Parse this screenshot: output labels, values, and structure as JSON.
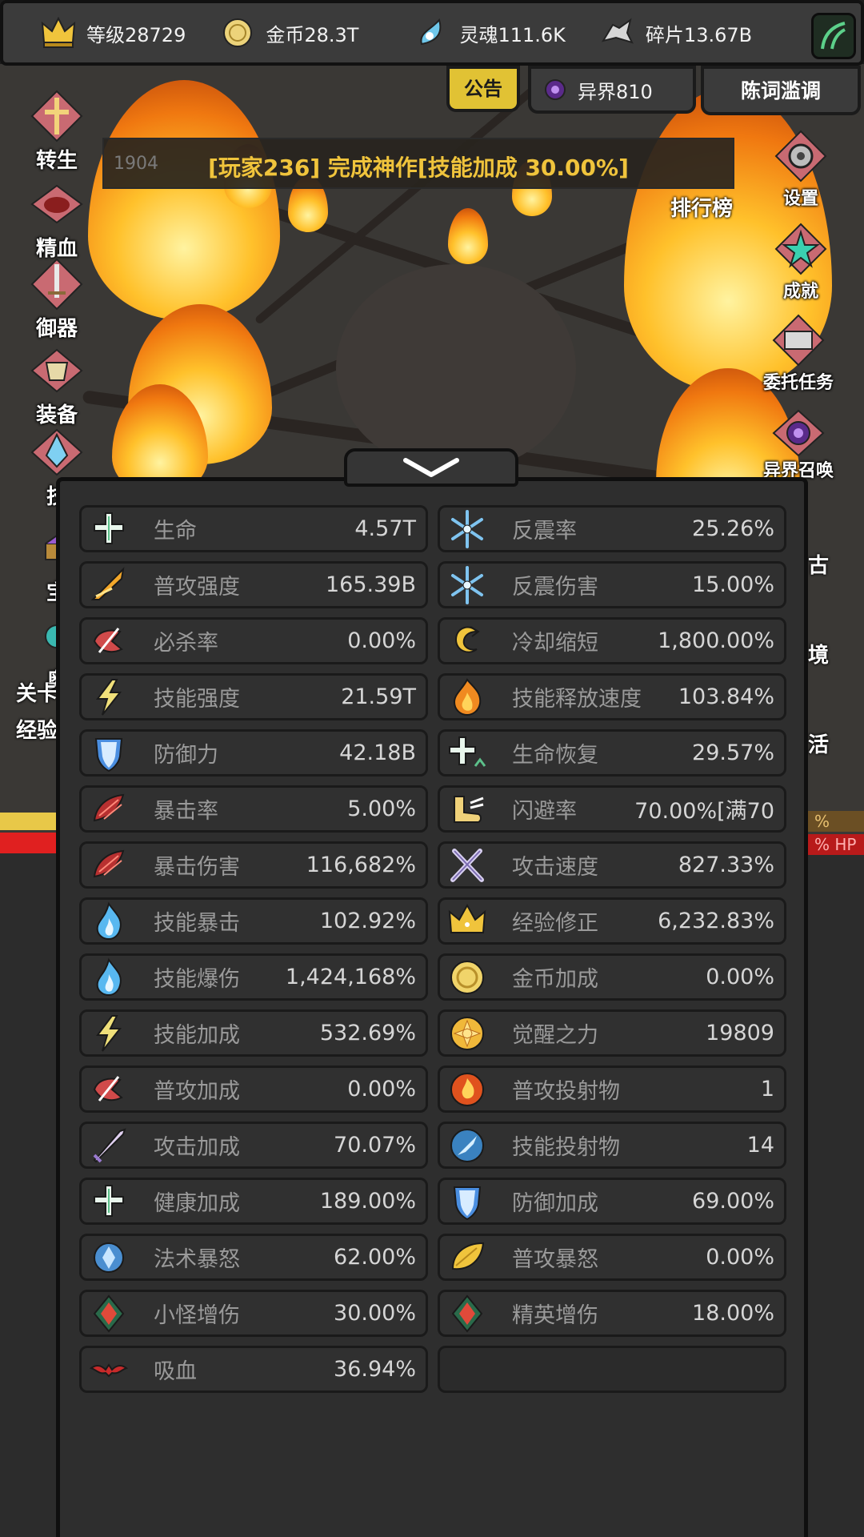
{
  "resources": [
    {
      "icon": "crown-icon",
      "label": "等级28729"
    },
    {
      "icon": "gold-coin-icon",
      "label": "金币28.3T"
    },
    {
      "icon": "soul-icon",
      "label": "灵魂111.6K"
    },
    {
      "icon": "fragment-icon",
      "label": "碎片13.67B"
    }
  ],
  "header": {
    "notice": "公告",
    "otherworld": "异界810",
    "player_name": "陈词滥调"
  },
  "banner": {
    "ghost_text": "1904",
    "message": "[玩家236] 完成神作[技能加成 30.00%]"
  },
  "ranking_label": "排行榜",
  "left_menu": [
    {
      "label": "转生",
      "icon": "rebirth-icon"
    },
    {
      "label": "精血",
      "icon": "blood-essence-icon"
    },
    {
      "label": "御器",
      "icon": "sword-artifact-icon"
    },
    {
      "label": "装备",
      "icon": "equipment-icon"
    },
    {
      "label": "技",
      "icon": "skill-crystal-icon"
    },
    {
      "label": "宝",
      "icon": "treasure-icon"
    },
    {
      "label": "奥",
      "icon": "arcane-icon"
    }
  ],
  "left_extra": {
    "stage": "关卡",
    "exp": "经验"
  },
  "right_menu": [
    {
      "label": "设置",
      "icon": "gear-icon"
    },
    {
      "label": "成就",
      "icon": "star-icon"
    },
    {
      "label": "委托任务",
      "icon": "quest-scroll-icon"
    },
    {
      "label": "异界召唤",
      "icon": "portal-icon"
    },
    {
      "label": "古",
      "icon": "ancient-icon"
    },
    {
      "label": "境",
      "icon": "realm-icon"
    },
    {
      "label": "活",
      "icon": "activity-icon"
    }
  ],
  "bars": {
    "exp": "% EXP",
    "hp": "% HP"
  },
  "stats_left": [
    {
      "name": "生命",
      "value": "4.57T",
      "icon": "health-cross-icon"
    },
    {
      "name": "普攻强度",
      "value": "165.39B",
      "icon": "arrow-attack-icon"
    },
    {
      "name": "必杀率",
      "value": "0.00%",
      "icon": "kill-rate-icon"
    },
    {
      "name": "技能强度",
      "value": "21.59T",
      "icon": "lightning-icon"
    },
    {
      "name": "防御力",
      "value": "42.18B",
      "icon": "shield-icon"
    },
    {
      "name": "暴击率",
      "value": "5.00%",
      "icon": "crit-claw-icon"
    },
    {
      "name": "暴击伤害",
      "value": "116,682%",
      "icon": "crit-claw-icon"
    },
    {
      "name": "技能暴击",
      "value": "102.92%",
      "icon": "blue-flame-icon"
    },
    {
      "name": "技能爆伤",
      "value": "1,424,168%",
      "icon": "blue-flame-icon"
    },
    {
      "name": "技能加成",
      "value": "532.69%",
      "icon": "lightning-icon"
    },
    {
      "name": "普攻加成",
      "value": "0.00%",
      "icon": "kill-rate-icon"
    },
    {
      "name": "攻击加成",
      "value": "70.07%",
      "icon": "sword-icon"
    },
    {
      "name": "健康加成",
      "value": "189.00%",
      "icon": "health-cross-icon"
    },
    {
      "name": "法术暴怒",
      "value": "62.00%",
      "icon": "magic-rune-icon"
    },
    {
      "name": "小怪增伤",
      "value": "30.00%",
      "icon": "red-diamond-icon"
    },
    {
      "name": "吸血",
      "value": "36.94%",
      "icon": "bat-icon"
    }
  ],
  "stats_right": [
    {
      "name": "反震率",
      "value": "25.26%",
      "icon": "frost-icon"
    },
    {
      "name": "反震伤害",
      "value": "15.00%",
      "icon": "frost-icon"
    },
    {
      "name": "冷却缩短",
      "value": "1,800.00%",
      "icon": "cooldown-swirl-icon"
    },
    {
      "name": "技能释放速度",
      "value": "103.84%",
      "icon": "orange-flame-icon"
    },
    {
      "name": "生命恢复",
      "value": "29.57%",
      "icon": "regen-cross-icon"
    },
    {
      "name": "闪避率",
      "value": "70.00%[满70",
      "icon": "winged-boot-icon"
    },
    {
      "name": "攻击速度",
      "value": "827.33%",
      "icon": "crossed-swords-icon"
    },
    {
      "name": "经验修正",
      "value": "6,232.83%",
      "icon": "crown-icon"
    },
    {
      "name": "金币加成",
      "value": "0.00%",
      "icon": "gold-coin-icon"
    },
    {
      "name": "觉醒之力",
      "value": "19809",
      "icon": "awaken-sun-icon"
    },
    {
      "name": "普攻投射物",
      "value": "1",
      "icon": "fire-orb-icon"
    },
    {
      "name": "技能投射物",
      "value": "14",
      "icon": "blue-dart-icon"
    },
    {
      "name": "防御加成",
      "value": "69.00%",
      "icon": "shield-icon"
    },
    {
      "name": "普攻暴怒",
      "value": "0.00%",
      "icon": "gold-leaf-icon"
    },
    {
      "name": "精英增伤",
      "value": "18.00%",
      "icon": "red-diamond-icon"
    },
    {
      "name": "",
      "value": "",
      "icon": ""
    }
  ],
  "colors": {
    "gold": "#f0c43c",
    "panel": "#2e2e2e",
    "cell": "#303030",
    "notice": "#e1c234"
  }
}
